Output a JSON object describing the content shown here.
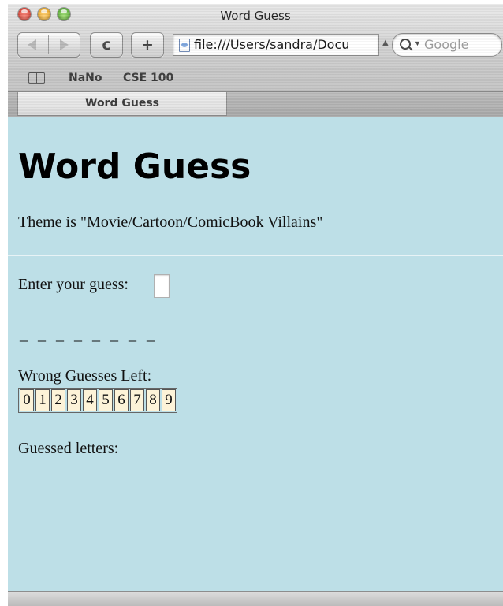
{
  "window": {
    "title": "Word Guess"
  },
  "toolbar": {
    "back_icon": "back-arrow-icon",
    "forward_icon": "forward-arrow-icon",
    "reload_glyph": "c",
    "add_glyph": "+",
    "url": "file:///Users/sandra/Docu",
    "search_placeholder": "Google"
  },
  "bookmarks": {
    "items": [
      "NaNo",
      "CSE 100"
    ]
  },
  "tabs": [
    {
      "label": "Word Guess"
    }
  ],
  "page": {
    "heading": "Word Guess",
    "theme": "Theme is \"Movie/Cartoon/ComicBook Villains\"",
    "guess_label": "Enter your guess:",
    "word_blanks": "_ _ _ _ _ _ _ _",
    "wrong_label": "Wrong Guesses Left:",
    "wrong_digits": [
      "0",
      "1",
      "2",
      "3",
      "4",
      "5",
      "6",
      "7",
      "8",
      "9"
    ],
    "guessed_label": "Guessed letters:"
  },
  "colors": {
    "page_background": "#bddfe7",
    "digit_background": "#fdf3d8"
  }
}
